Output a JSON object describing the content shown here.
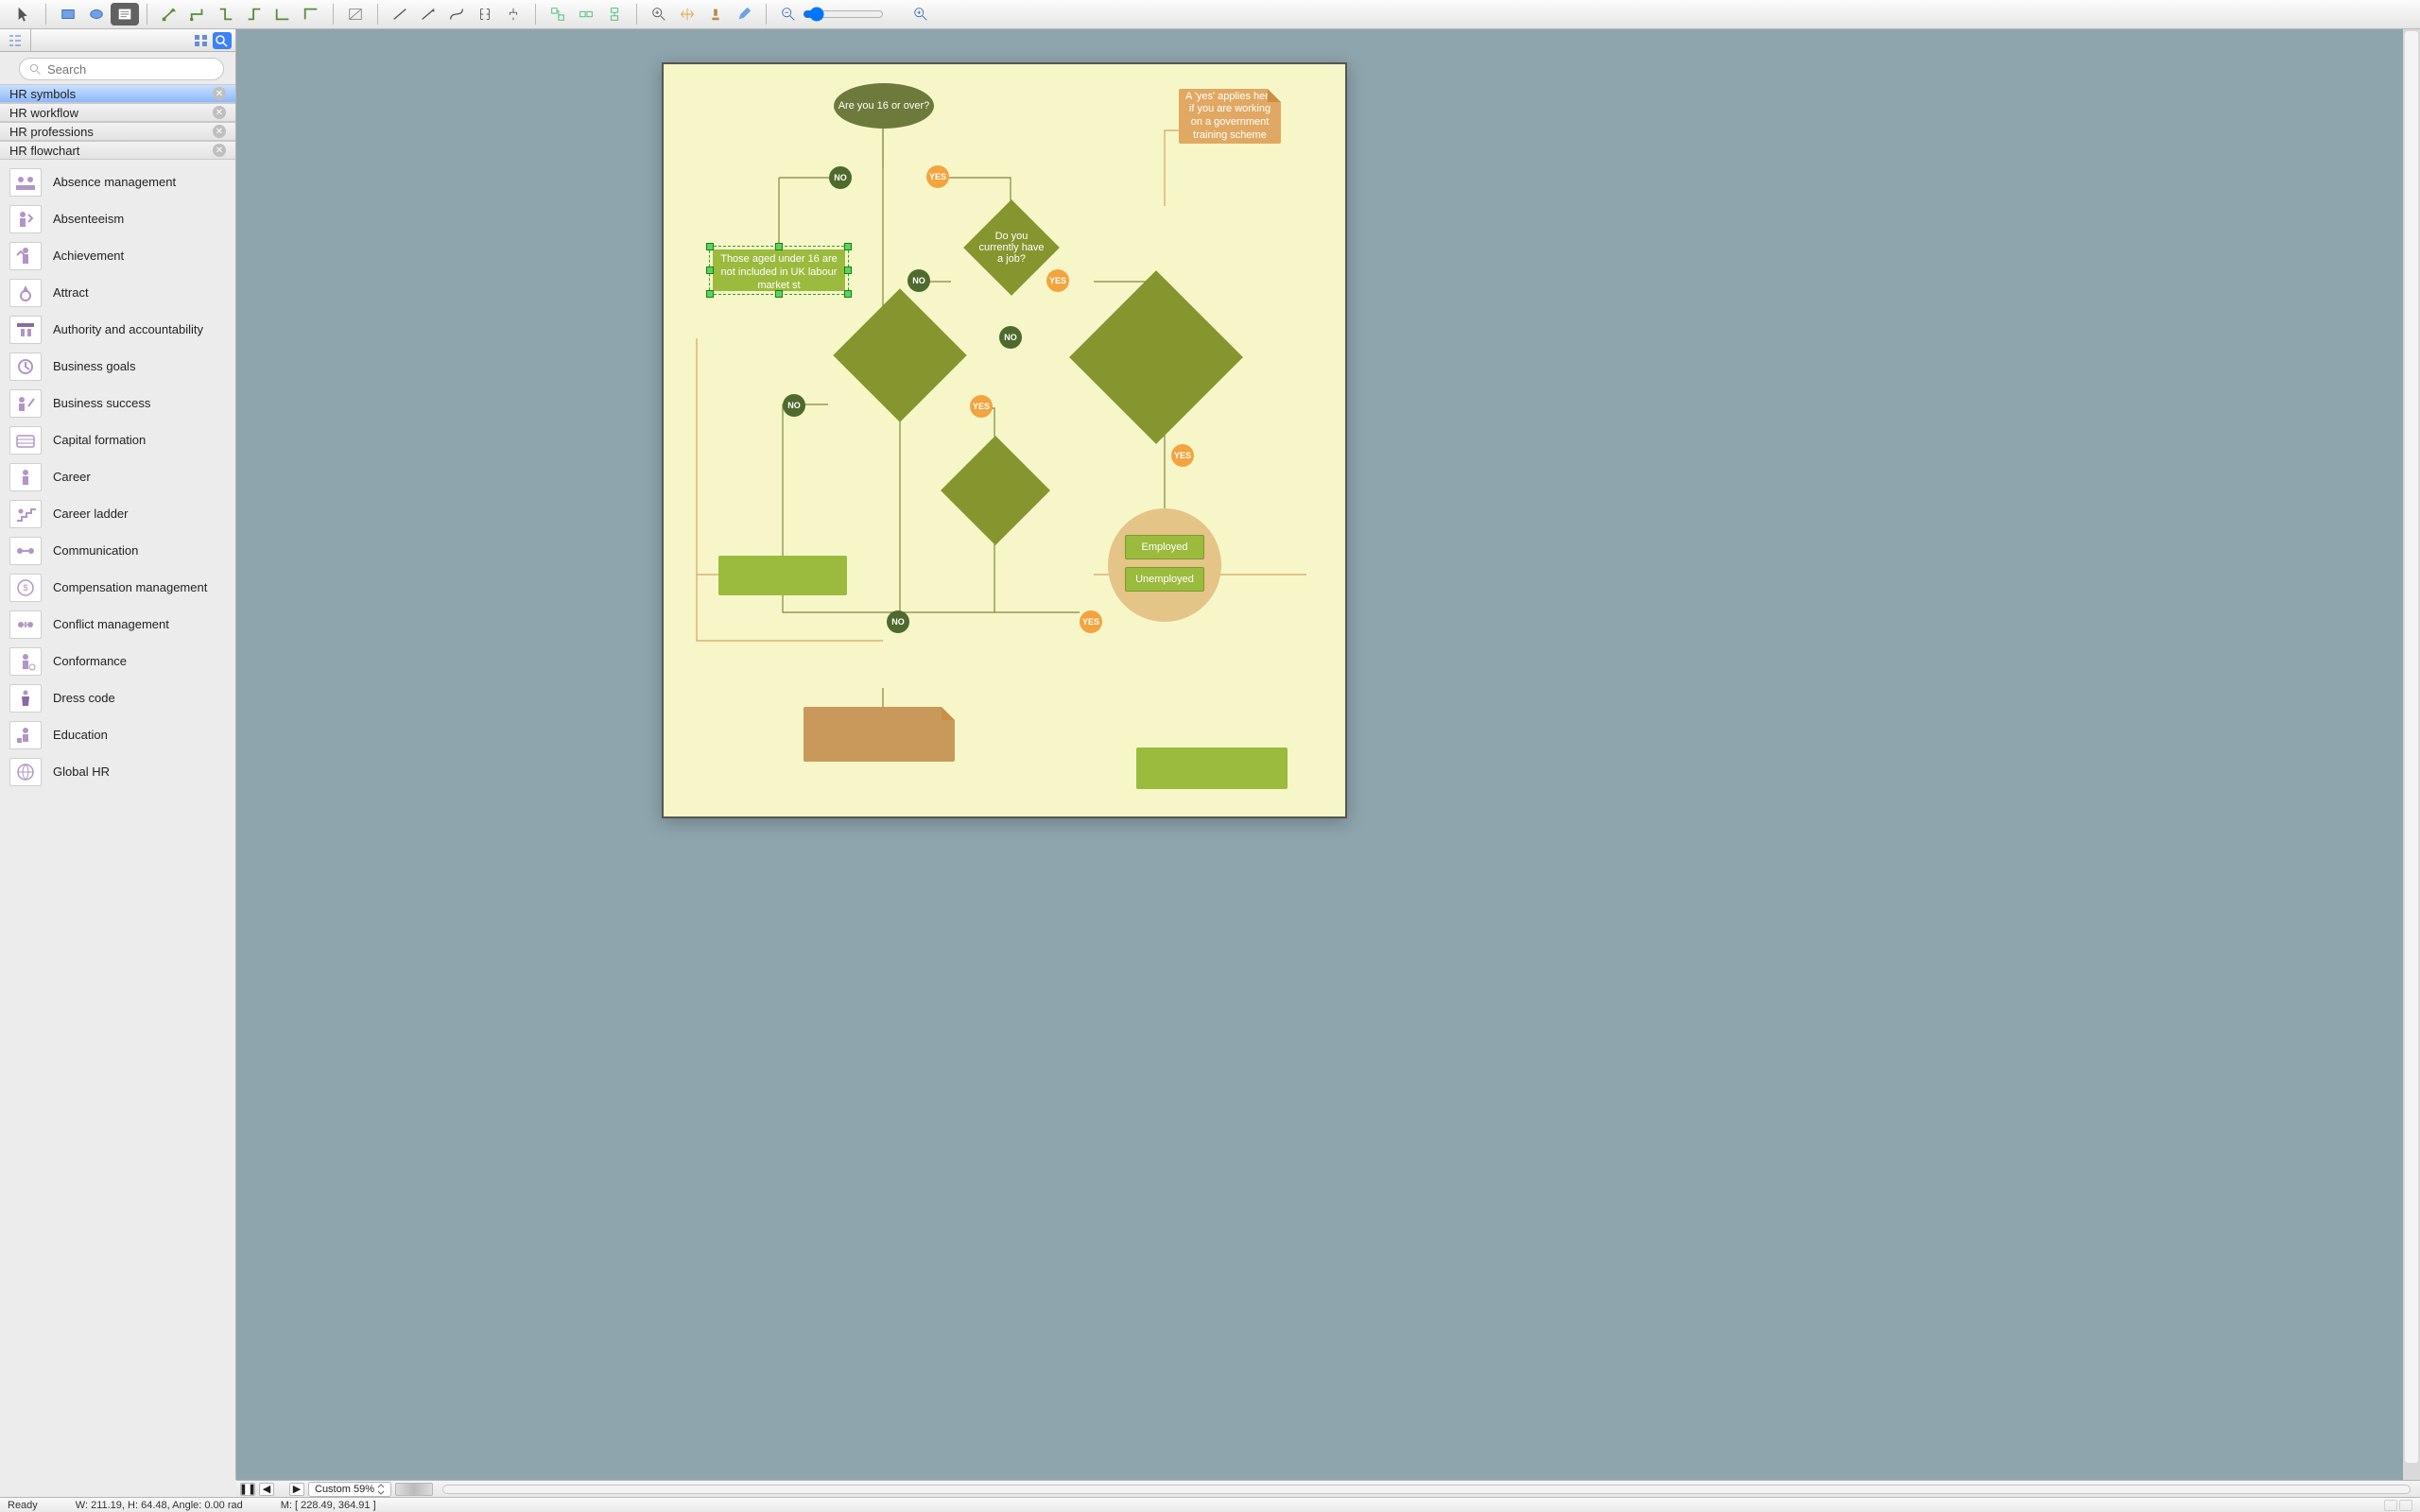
{
  "search": {
    "placeholder": "Search"
  },
  "libraries": [
    {
      "name": "HR symbols",
      "selected": true
    },
    {
      "name": "HR workflow",
      "selected": false
    },
    {
      "name": "HR professions",
      "selected": false
    },
    {
      "name": "HR flowchart",
      "selected": false
    }
  ],
  "lib_items": [
    "Absence management",
    "Absenteeism",
    "Achievement",
    "Attract",
    "Authority and accountability",
    "Business goals",
    "Business success",
    "Capital formation",
    "Career",
    "Career ladder",
    "Communication",
    "Compensation management",
    "Conflict management",
    "Conformance",
    "Dress code",
    "Education",
    "Global HR"
  ],
  "flow": {
    "start": "Are you 16 or over?",
    "note_right": "A 'yes' applies here if you are working on a government training scheme",
    "under16": "Those aged under 16 are not included in UK labour market st",
    "have_job": "Do you currently have a job?",
    "employed": "Employed",
    "unemployed": "Unemployed",
    "no": "NO",
    "yes": "YES"
  },
  "hscroll": {
    "zoom_label": "Custom 59%"
  },
  "status": {
    "ready": "Ready",
    "dims": "W: 211.19,  H: 64.48,  Angle: 0.00 rad",
    "mouse": "M: [ 228.49, 364.91 ]"
  }
}
